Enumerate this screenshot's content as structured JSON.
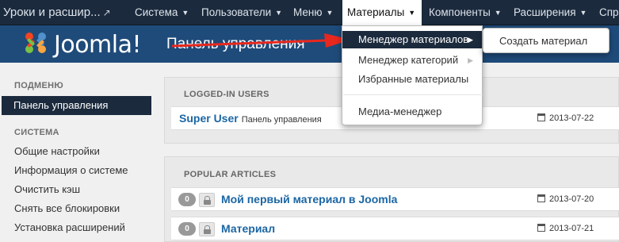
{
  "navbar": {
    "brand": "Уроки и расшир...",
    "items": [
      {
        "label": "Система"
      },
      {
        "label": "Пользователи"
      },
      {
        "label": "Меню"
      },
      {
        "label": "Материалы"
      },
      {
        "label": "Компоненты"
      },
      {
        "label": "Расширения"
      },
      {
        "label": "Спр"
      }
    ],
    "active_index": 3
  },
  "header": {
    "logo_text": "Joomla!",
    "page_title": "Панель управления"
  },
  "dropdown": {
    "items": [
      {
        "label": "Менеджер материалов",
        "highlighted": true,
        "has_submenu": true
      },
      {
        "label": "Менеджер категорий",
        "highlighted": false,
        "has_submenu": true
      },
      {
        "label": "Избранные материалы",
        "highlighted": false,
        "has_submenu": false
      },
      {
        "label": "Медиа-менеджер",
        "highlighted": false,
        "has_submenu": false
      }
    ],
    "submenu": {
      "items": [
        {
          "label": "Создать материал"
        }
      ]
    }
  },
  "sidebar": {
    "submenu_heading": "ПОДМЕНЮ",
    "active_item": "Панель управления",
    "system_heading": "СИСТЕМА",
    "items": [
      {
        "label": "Общие настройки"
      },
      {
        "label": "Информация о системе"
      },
      {
        "label": "Очистить кэш"
      },
      {
        "label": "Снять все блокировки"
      },
      {
        "label": "Установка расширений"
      }
    ]
  },
  "logged_in": {
    "heading": "LOGGED-IN USERS",
    "rows": [
      {
        "name": "Super User",
        "location": "Панель управления",
        "date": "2013-07-22"
      }
    ]
  },
  "popular": {
    "heading": "POPULAR ARTICLES",
    "rows": [
      {
        "hits": "0",
        "title": "Мой первый материал в Joomla",
        "date": "2013-07-20"
      },
      {
        "hits": "0",
        "title": "Материал",
        "date": "2013-07-21"
      }
    ]
  },
  "colors": {
    "navbar": "#1b2a3d",
    "header": "#1f4b7a",
    "link": "#1b66a4",
    "arrow": "#e8281e"
  }
}
